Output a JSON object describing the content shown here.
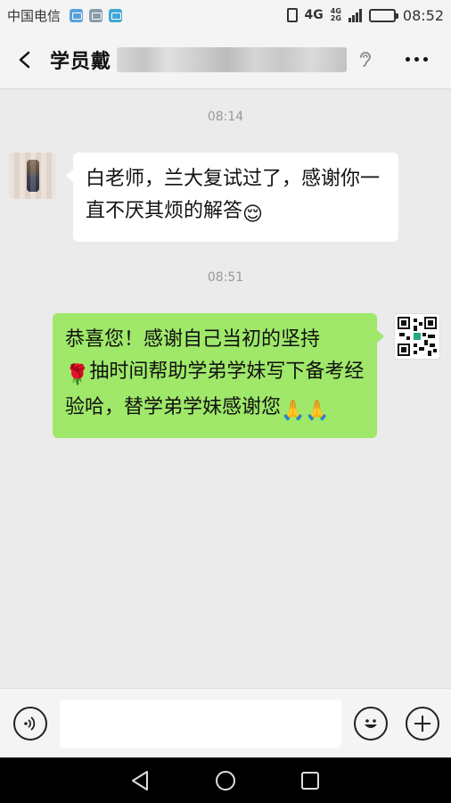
{
  "status_bar": {
    "carrier": "中国电信",
    "network": "4G",
    "network_small_top": "4G",
    "network_small_bottom": "2G",
    "time": "08:52"
  },
  "header": {
    "title": "学员戴",
    "icons": [
      "back-icon",
      "earpiece-icon",
      "more-icon"
    ]
  },
  "chat": {
    "messages": [
      {
        "time": "08:14",
        "side": "left",
        "text": "白老师，兰大复试过了，感谢你一直不厌其烦的解答",
        "emoji": "😌"
      },
      {
        "time": "08:51",
        "side": "right",
        "text_1": "恭喜您！感谢自己当初的坚持",
        "text_2": "抽时间帮助学弟学妹写下备考经验哈，替学弟学妹感谢您",
        "emoji_rose": "🌹",
        "emoji_hands": "🙏🙏"
      }
    ]
  },
  "input_bar": {
    "value": "",
    "icons": [
      "voice-icon",
      "emoji-icon",
      "plus-icon"
    ]
  },
  "colors": {
    "sent_bubble": "#9fe86a",
    "received_bubble": "#ffffff",
    "chat_background": "#ebebeb"
  }
}
